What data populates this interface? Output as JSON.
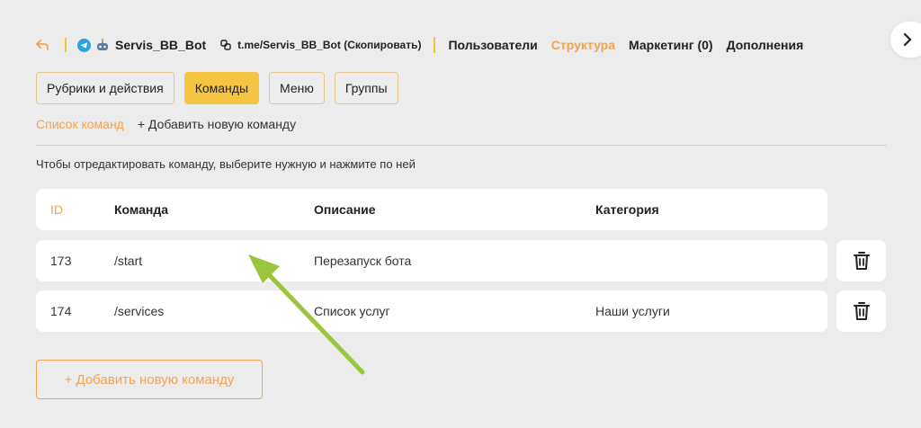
{
  "header": {
    "bot_name": "Servis_BB_Bot",
    "bot_link": "t.me/Servis_BB_Bot (Скопировать)",
    "nav": [
      {
        "label": "Пользователи",
        "active": false
      },
      {
        "label": "Структура",
        "active": true
      },
      {
        "label": "Маркетинг (0)",
        "active": false
      },
      {
        "label": "Дополнения",
        "active": false
      }
    ]
  },
  "subtabs": [
    {
      "label": "Рубрики и действия",
      "active": false
    },
    {
      "label": "Команды",
      "active": true
    },
    {
      "label": "Меню",
      "active": false
    },
    {
      "label": "Группы",
      "active": false
    }
  ],
  "actions": {
    "list_label": "Список команд",
    "add_label": "+ Добавить новую команду"
  },
  "hint": "Чтобы отредактировать команду, выберите нужную и нажмите по ней",
  "table": {
    "columns": [
      "ID",
      "Команда",
      "Описание",
      "Категория"
    ],
    "rows": [
      {
        "id": "173",
        "command": "/start",
        "description": "Перезапуск бота",
        "category": ""
      },
      {
        "id": "174",
        "command": "/services",
        "description": "Список услуг",
        "category": "Наши услуги"
      }
    ]
  },
  "add_button": "+ Добавить новую команду",
  "colors": {
    "accent": "#f0a355",
    "active_tab": "#f5c542",
    "annotation_arrow": "#9bc53d"
  },
  "icons": [
    "back-arrow-icon",
    "telegram-icon",
    "bot-avatar-icon",
    "copy-link-icon",
    "chevron-right-icon",
    "trash-icon"
  ]
}
